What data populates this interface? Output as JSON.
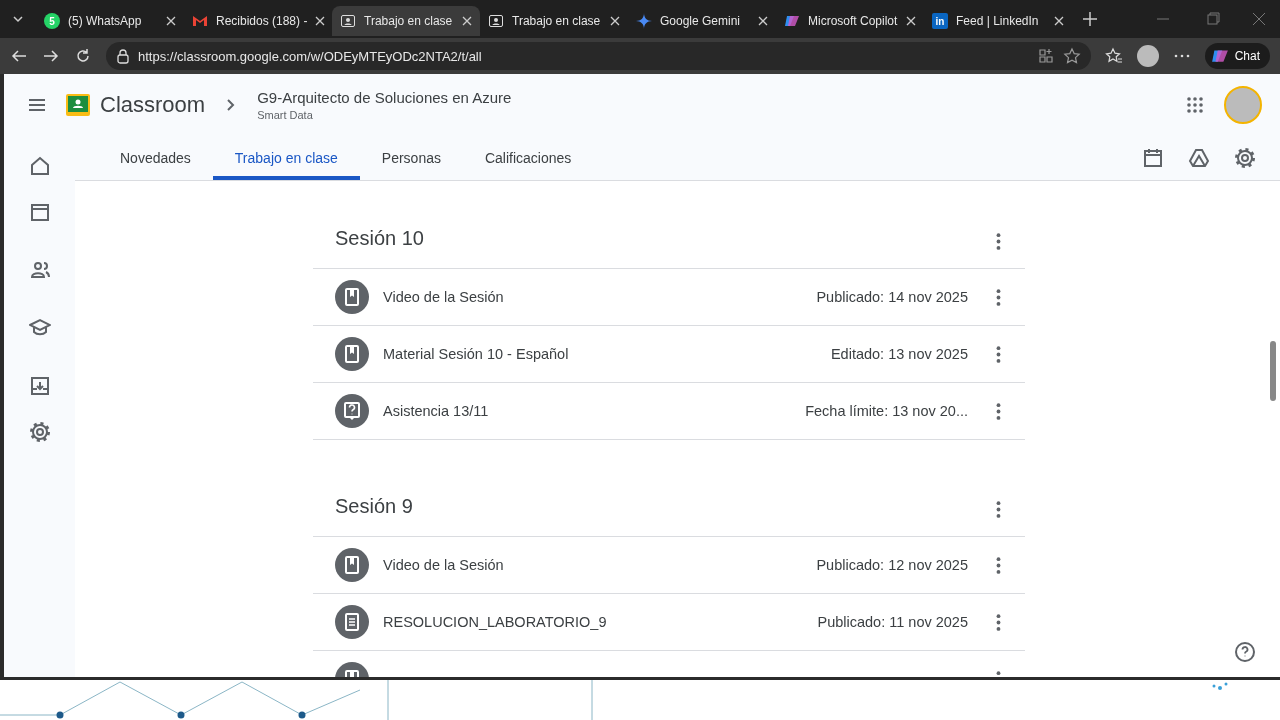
{
  "browser": {
    "tabs": [
      {
        "title": "(5) WhatsApp",
        "badge": "5",
        "selected": false
      },
      {
        "title": "Recibidos (188) -",
        "selected": false
      },
      {
        "title": "Trabajo en clase",
        "selected": true
      },
      {
        "title": "Trabajo en clase",
        "selected": false
      },
      {
        "title": "Google Gemini",
        "selected": false
      },
      {
        "title": "Microsoft Copilot",
        "selected": false
      },
      {
        "title": "Feed | LinkedIn",
        "badge": "in",
        "selected": false
      }
    ],
    "url": "https://classroom.google.com/w/ODEyMTEyODc2NTA2/t/all",
    "chat": "Chat"
  },
  "app": {
    "brand": "Classroom",
    "course": "G9-Arquitecto de Soluciones en Azure",
    "section": "Smart Data",
    "nav": [
      {
        "label": "Novedades",
        "selected": false
      },
      {
        "label": "Trabajo en clase",
        "selected": true
      },
      {
        "label": "Personas",
        "selected": false
      },
      {
        "label": "Calificaciones",
        "selected": false
      }
    ],
    "topics": [
      {
        "title": "Sesión 10",
        "items": [
          {
            "kind": "material",
            "title": "Video de la Sesión",
            "status": "Publicado: 14 nov 2025"
          },
          {
            "kind": "material",
            "title": "Material Sesión 10 - Español",
            "status": "Editado: 13 nov 2025"
          },
          {
            "kind": "question",
            "title": "Asistencia 13/11",
            "status": "Fecha límite: 13 nov 20..."
          }
        ]
      },
      {
        "title": "Sesión 9",
        "items": [
          {
            "kind": "material",
            "title": "Video de la Sesión",
            "status": "Publicado: 12 nov 2025"
          },
          {
            "kind": "assignment",
            "title": "RESOLUCION_LABORATORIO_9",
            "status": "Publicado: 11 nov 2025"
          },
          {
            "kind": "material"
          }
        ]
      }
    ]
  }
}
